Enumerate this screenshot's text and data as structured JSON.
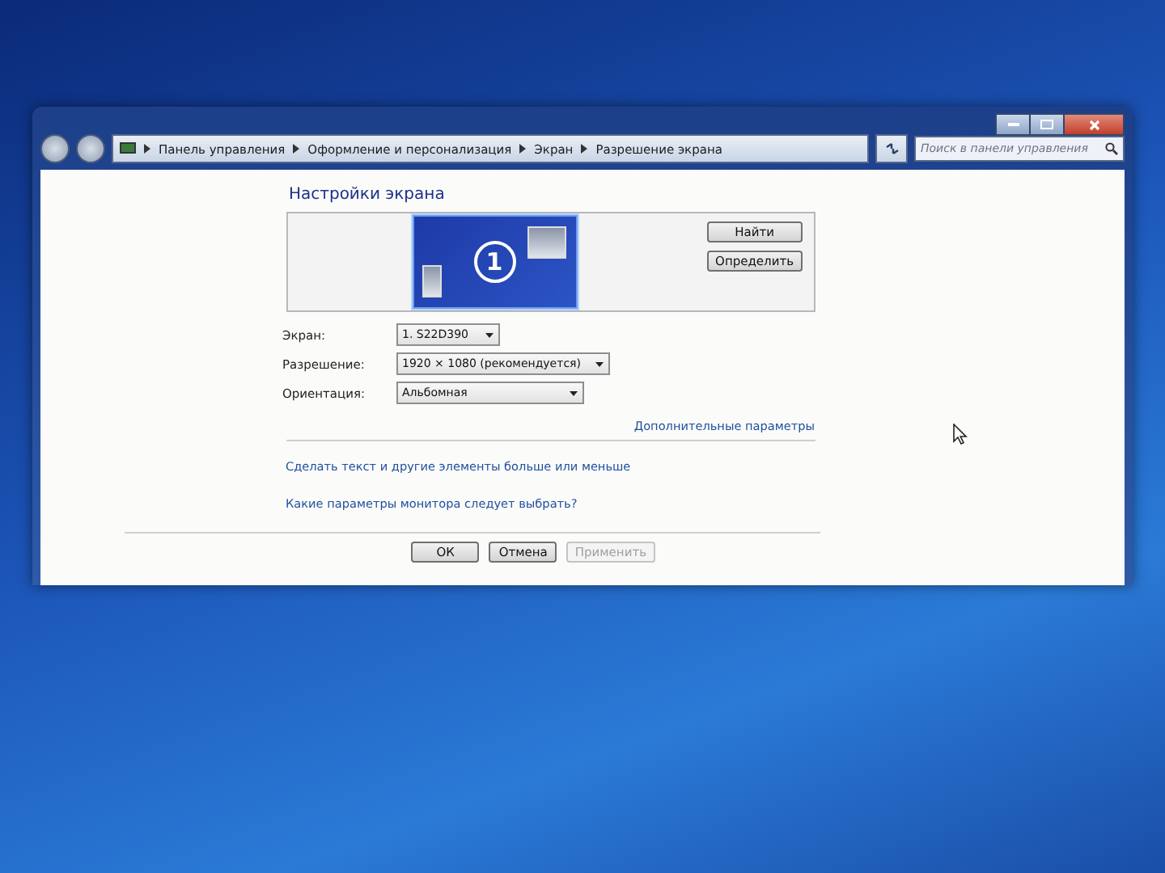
{
  "address_bar": {
    "breadcrumbs": [
      "Панель управления",
      "Оформление и персонализация",
      "Экран",
      "Разрешение экрана"
    ]
  },
  "search": {
    "placeholder": "Поиск в панели управления"
  },
  "heading": "Настройки экрана",
  "preview": {
    "monitor_number": "1",
    "buttons": [
      {
        "label": "Найти"
      },
      {
        "label": "Определить"
      }
    ]
  },
  "fields": [
    {
      "label": "Экран:",
      "value": "1. S22D390"
    },
    {
      "label": "Разрешение:",
      "value": "1920 × 1080 (рекомендуется)"
    },
    {
      "label": "Ориентация:",
      "value": "Альбомная"
    }
  ],
  "advanced_link": "Дополнительные параметры",
  "links": [
    "Сделать текст и другие элементы больше или меньше",
    "Какие параметры монитора следует выбрать?"
  ],
  "buttons": [
    {
      "label": "ОК",
      "disabled": false
    },
    {
      "label": "Отмена",
      "disabled": false
    },
    {
      "label": "Применить",
      "disabled": true
    }
  ]
}
